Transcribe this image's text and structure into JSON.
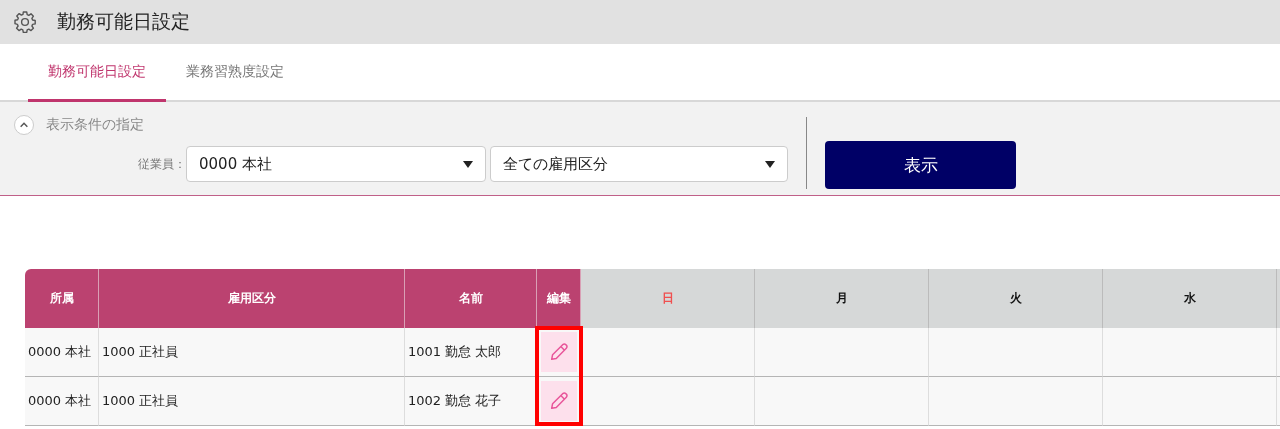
{
  "window": {
    "title": "勤務可能日設定"
  },
  "tabs": [
    {
      "label": "勤務可能日設定",
      "selected": true
    },
    {
      "label": "業務習熟度設定",
      "selected": false
    }
  ],
  "filter": {
    "title": "表示条件の指定",
    "expanded": true,
    "employee_label": "従業員：",
    "office_select": "0000 本社",
    "employment_select": "全ての雇用区分",
    "submit": "表示"
  },
  "table": {
    "columns": [
      {
        "label": "所属",
        "kind": "info"
      },
      {
        "label": "雇用区分",
        "kind": "info"
      },
      {
        "label": "名前",
        "kind": "info"
      },
      {
        "label": "編集",
        "kind": "edit"
      },
      {
        "label": "日",
        "kind": "sunday"
      },
      {
        "label": "月",
        "kind": "day"
      },
      {
        "label": "火",
        "kind": "day"
      },
      {
        "label": "水",
        "kind": "day"
      }
    ],
    "edit_column_highlighted": true,
    "rows": [
      {
        "cells": [
          "0000 本社",
          "1000 正社員",
          "1001 勤怠 太郎"
        ]
      },
      {
        "cells": [
          "0000 本社",
          "1000 正社員",
          "1002 勤怠 花子"
        ]
      }
    ]
  }
}
